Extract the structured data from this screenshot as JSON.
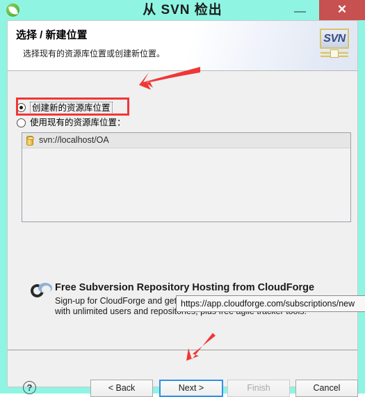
{
  "window": {
    "title": "从 SVN 检出",
    "app_icon": "leaf-logo-icon",
    "minimize_label": "−",
    "maximize_label": "□",
    "close_label": "✕",
    "titlebar_color": "#8ff5e2",
    "close_button_color": "#c75050"
  },
  "header": {
    "title": "选择 / 新建位置",
    "subtitle": "选择现有的资源库位置或创建新位置。",
    "badge_text": "SVN"
  },
  "options": {
    "create_new": {
      "label": "创建新的资源库位置",
      "selected": true,
      "highlighted": true,
      "highlight_color": "#f13636"
    },
    "use_existing": {
      "label": "使用现有的资源库位置：",
      "selected": false
    }
  },
  "repository_list": {
    "enabled": false,
    "items": [
      {
        "label": "svn://localhost/OA",
        "icon": "repository-cylinder-icon"
      }
    ]
  },
  "promo": {
    "logo": "cloudforge-cloud-icon",
    "title": "Free Subversion Repository Hosting from CloudForge",
    "line1": "Sign-up for CloudForge and get free Subversion repository hosting",
    "line2": "with unlimited users and repositories, plus free agile tracker tools."
  },
  "tooltip": {
    "text": "https://app.cloudforge.com/subscriptions/new"
  },
  "footer": {
    "help_label": "?",
    "buttons": [
      {
        "label": "< Back",
        "enabled": true,
        "focused": false
      },
      {
        "label": "Next >",
        "enabled": true,
        "focused": true
      },
      {
        "label": "Finish",
        "enabled": false,
        "focused": false
      },
      {
        "label": "Cancel",
        "enabled": true,
        "focused": false
      }
    ]
  },
  "annotations": {
    "arrow_to_radio": "red-arrow-pointing-left",
    "arrow_to_next": "red-arrow-pointing-down-left",
    "color": "#f13636"
  }
}
